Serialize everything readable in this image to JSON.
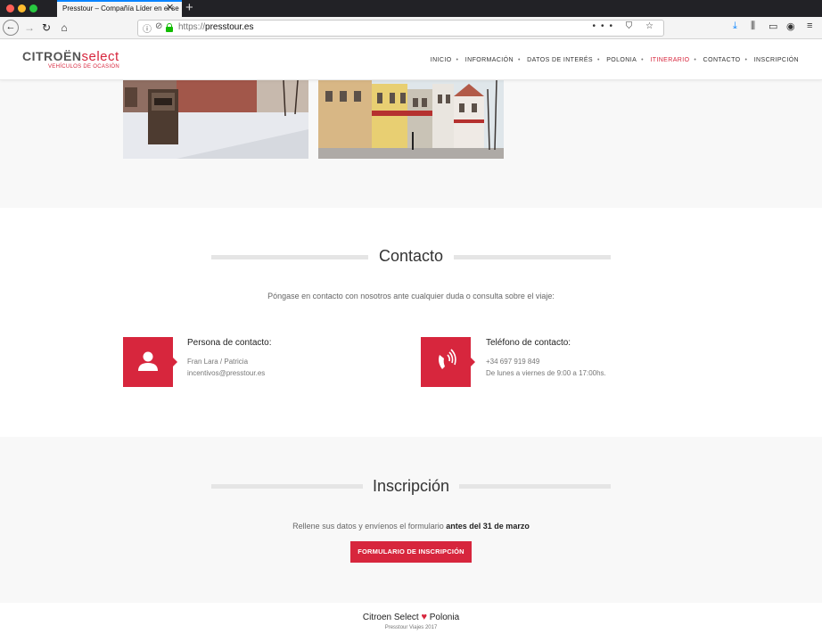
{
  "browser": {
    "tab_title": "Presstour – Compañía Líder en el se",
    "tab_close": "✕",
    "new_tab": "+",
    "url_protocol": "https://",
    "url_host": "presstour.es",
    "url_actions": "••• ⛉ ☆",
    "back_icon": "←",
    "forward_icon": "→",
    "reload_icon": "↻",
    "home_icon": "⌂",
    "info_icon": "ⓘ",
    "tracking_icon": "⊘",
    "toolbar": {
      "download": "⤓",
      "library": "⫼",
      "sidebar": "▭",
      "account": "◉",
      "menu": "≡"
    }
  },
  "logo": {
    "brand": "CITROËN",
    "select": "select",
    "tagline": "VEHÍCULOS DE OCASIÓN"
  },
  "nav": {
    "items": [
      "INICIO",
      "INFORMACIÓN",
      "DATOS DE INTERÉS",
      "POLONIA",
      "ITINERARIO",
      "CONTACTO",
      "INSCRIPCIÓN"
    ],
    "separator": "•",
    "active": "ITINERARIO"
  },
  "contact": {
    "title": "Contacto",
    "lead": "Póngase en contacto con nosotros ante cualquier duda o consulta sobre el viaje:",
    "person": {
      "title": "Persona de contacto:",
      "name": "Fran Lara / Patricia",
      "email": "incentivos@presstour.es"
    },
    "phone": {
      "title": "Teléfono de contacto:",
      "number": "+34 697 919 849",
      "hours": "De lunes a viernes de 9:00 a 17:00hs."
    }
  },
  "inscripcion": {
    "title": "Inscripción",
    "lead_prefix": "Rellene sus datos y envíenos el formulario",
    "lead_bold": "antes del 31 de marzo",
    "button": "FORMULARIO DE INSCRIPCIÓN"
  },
  "footer": {
    "brand_left": "Citroen Select",
    "heart": "♥",
    "brand_right": "Polonia",
    "copyright": "Presstour Viajes 2017"
  },
  "colors": {
    "accent": "#d7263d",
    "section_bg": "#f8f8f8"
  }
}
